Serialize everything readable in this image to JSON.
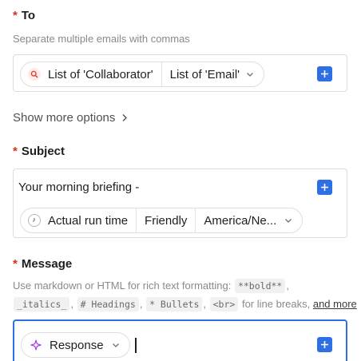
{
  "to": {
    "required_mark": "*",
    "label": "To",
    "hint": "Separate multiple emails with commas",
    "token": {
      "icon": "search-icon",
      "segments": [
        "List of 'Collaborator'",
        "List of 'Email'"
      ]
    }
  },
  "show_more": {
    "label": "Show more options"
  },
  "subject": {
    "required_mark": "*",
    "label": "Subject",
    "text": "Your morning briefing -",
    "token": {
      "icon": "clock-icon",
      "segments": [
        "Actual run time",
        "Friendly",
        "America/Ne..."
      ]
    }
  },
  "message": {
    "required_mark": "*",
    "label": "Message",
    "hint_prefix": "Use markdown or HTML for rich text formatting:",
    "examples": [
      "**bold**",
      "_italics_",
      "# Headings",
      "* Bullets",
      "<br>"
    ],
    "separator": ",",
    "hint_suffix": "for line breaks,",
    "more_link": "and more",
    "token": {
      "icon": "sparkle-icon",
      "label": "Response"
    }
  },
  "colors": {
    "accent": "#2f6fe4",
    "required": "#d92d20",
    "search_icon": "#e0453a",
    "sparkle_icon": "#a23ee0"
  }
}
